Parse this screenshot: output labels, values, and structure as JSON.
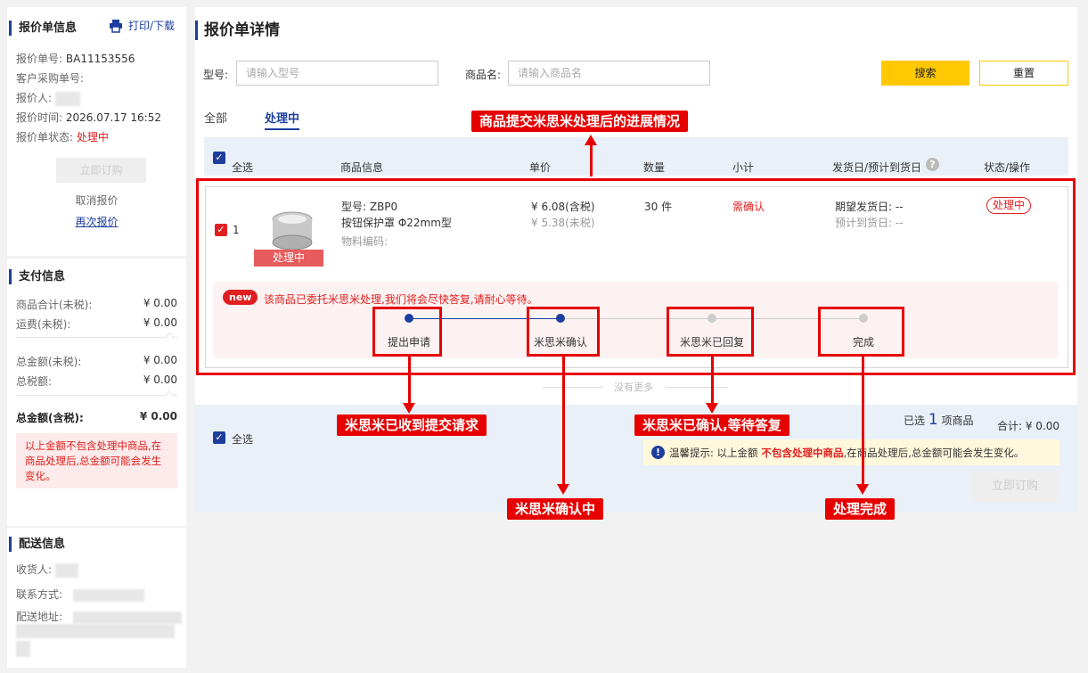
{
  "quote_info": {
    "title": "报价单信息",
    "print_label": "打印/下载",
    "quote_no_label": "报价单号:",
    "quote_no": "BA11153556",
    "customer_po_label": "客户采购单号:",
    "quoter_label": "报价人:",
    "time_label": "报价时间:",
    "time": "2026.07.17 16:52",
    "status_label": "报价单状态:",
    "status": "处理中",
    "order_now": "立即订购",
    "cancel_quote": "取消报价",
    "requote": "再次报价"
  },
  "payment": {
    "title": "支付信息",
    "goods_total_label": "商品合计(未税):",
    "goods_total": "¥ 0.00",
    "freight_label": "运费(未税):",
    "freight": "¥ 0.00",
    "total_untaxed_label": "总金额(未税):",
    "total_untaxed": "¥ 0.00",
    "tax_label": "总税额:",
    "tax": "¥ 0.00",
    "total_taxed_label": "总金额(含税):",
    "total_taxed": "¥ 0.00",
    "notice": "以上金额不包含处理中商品,在商品处理后,总金额可能会发生变化。"
  },
  "shipping": {
    "title": "配送信息",
    "receiver_label": "收货人:",
    "contact_label": "联系方式:",
    "address_label": "配送地址:"
  },
  "main": {
    "title": "报价单详情",
    "model_label": "型号:",
    "model_placeholder": "请输入型号",
    "name_label": "商品名:",
    "name_placeholder": "请输入商品名",
    "search": "搜索",
    "reset": "重置",
    "tabs": [
      "全部",
      "处理中"
    ],
    "select_all": "全选",
    "headers": [
      "商品信息",
      "单价",
      "数量",
      "小计",
      "发货日/预计到货日",
      "状态/操作"
    ],
    "item": {
      "index": "1",
      "model": "型号: ZBP0",
      "name": "按钮保护罩 Φ22mm型",
      "material_code": "物料编码:",
      "image_badge": "处理中",
      "price_taxed": "¥ 6.08(含税)",
      "price_untaxed": "¥ 5.38(未税)",
      "qty": "30 件",
      "subtotal": "需确认",
      "ship_expected": "期望发货日: --",
      "arrival_expected": "预计到货日: --",
      "status": "处理中"
    },
    "new_badge": "new",
    "new_message": "该商品已委托米思米处理,我们将会尽快答复,请耐心等待。",
    "steps": [
      "提出申请",
      "米思米确认",
      "米思米已回复",
      "完成"
    ],
    "no_more": "没有更多",
    "footer": {
      "select_all": "全选",
      "selected_prefix": "已选",
      "selected_count": "1",
      "selected_suffix": "项商品",
      "total": "合计: ¥ 0.00",
      "tip_prefix": "温馨提示: 以上金额",
      "tip_bold": "不包含处理中商品",
      "tip_suffix": ",在商品处理后,总金额可能会发生变化。",
      "order_now": "立即订购"
    }
  },
  "annotations": {
    "progress": "商品提交米思米处理后的进展情况",
    "received": "米思米已收到提交请求",
    "confirming": "米思米确认中",
    "confirmed": "米思米已确认,等待答复",
    "done": "处理完成"
  },
  "colors": {
    "accent_blue": "#1d3e9e",
    "annotation_red": "#e60000",
    "search_yellow": "#ffc800"
  }
}
